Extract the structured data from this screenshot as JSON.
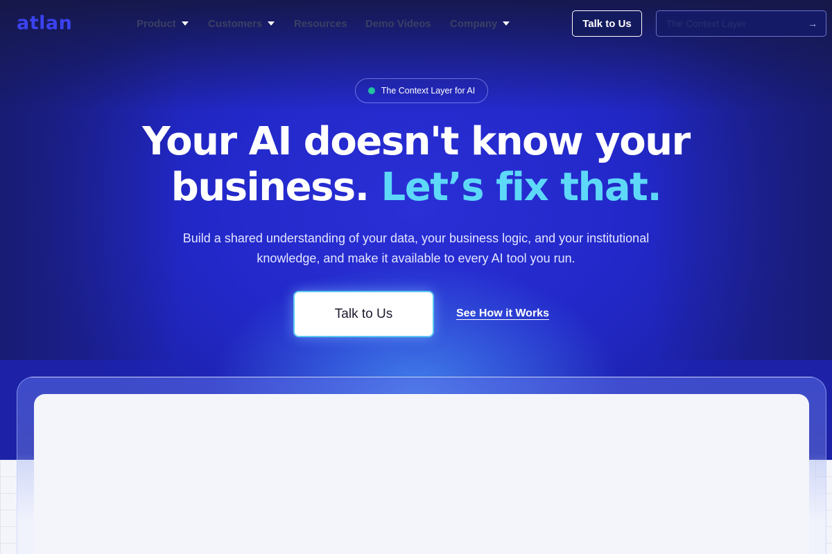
{
  "brand": {
    "logo_text": "atlan",
    "accent_color": "#3a42f0"
  },
  "nav": {
    "items": [
      {
        "label": "Product",
        "has_dropdown": true
      },
      {
        "label": "Customers",
        "has_dropdown": true
      },
      {
        "label": "Resources",
        "has_dropdown": false
      },
      {
        "label": "Demo Videos",
        "has_dropdown": false
      },
      {
        "label": "Company",
        "has_dropdown": true
      }
    ],
    "cta_label": "Talk to Us",
    "search_placeholder": "The Context Layer"
  },
  "hero": {
    "pill_text": "The Context Layer for AI",
    "headline_line1": "Your AI doesn't know your",
    "headline_line2": "business.",
    "headline_accent": "Let’s fix that.",
    "subtext": "Build a shared understanding of your data, your business logic, and your institutional knowledge, and make it available to every AI tool you run.",
    "primary_cta": "Talk to Us",
    "secondary_cta": "See How it Works"
  },
  "colors": {
    "hero_blue": "#2228c8",
    "accent_cyan": "#5ed8f8",
    "status_green": "#22c1a0"
  }
}
